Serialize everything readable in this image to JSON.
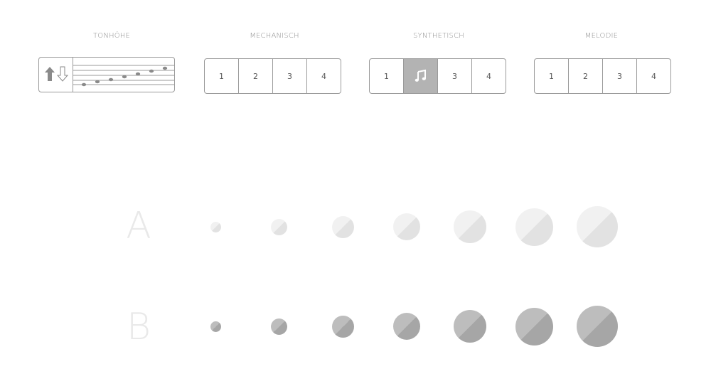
{
  "groups": {
    "pitch": {
      "label": "TONHÖHE"
    },
    "mechanical": {
      "label": "MECHANISCH",
      "buttons": [
        "1",
        "2",
        "3",
        "4"
      ],
      "selected": null
    },
    "synthetic": {
      "label": "SYNTHETISCH",
      "buttons": [
        "1",
        "♫",
        "3",
        "4"
      ],
      "selected": 1
    },
    "melody": {
      "label": "MELODIE",
      "buttons": [
        "1",
        "2",
        "3",
        "4"
      ],
      "selected": null
    }
  },
  "rows": [
    {
      "label": "A",
      "light": "#f1f1f1",
      "dark": "#e2e2e2",
      "dot_count": 7
    },
    {
      "label": "B",
      "light": "#bdbdbd",
      "dark": "#a6a6a6",
      "dot_count": 7
    }
  ],
  "icons": {
    "pitch_arrows": "up-down-arrows-icon",
    "staff": "music-staff-icon",
    "active_note": "music-note-icon"
  }
}
